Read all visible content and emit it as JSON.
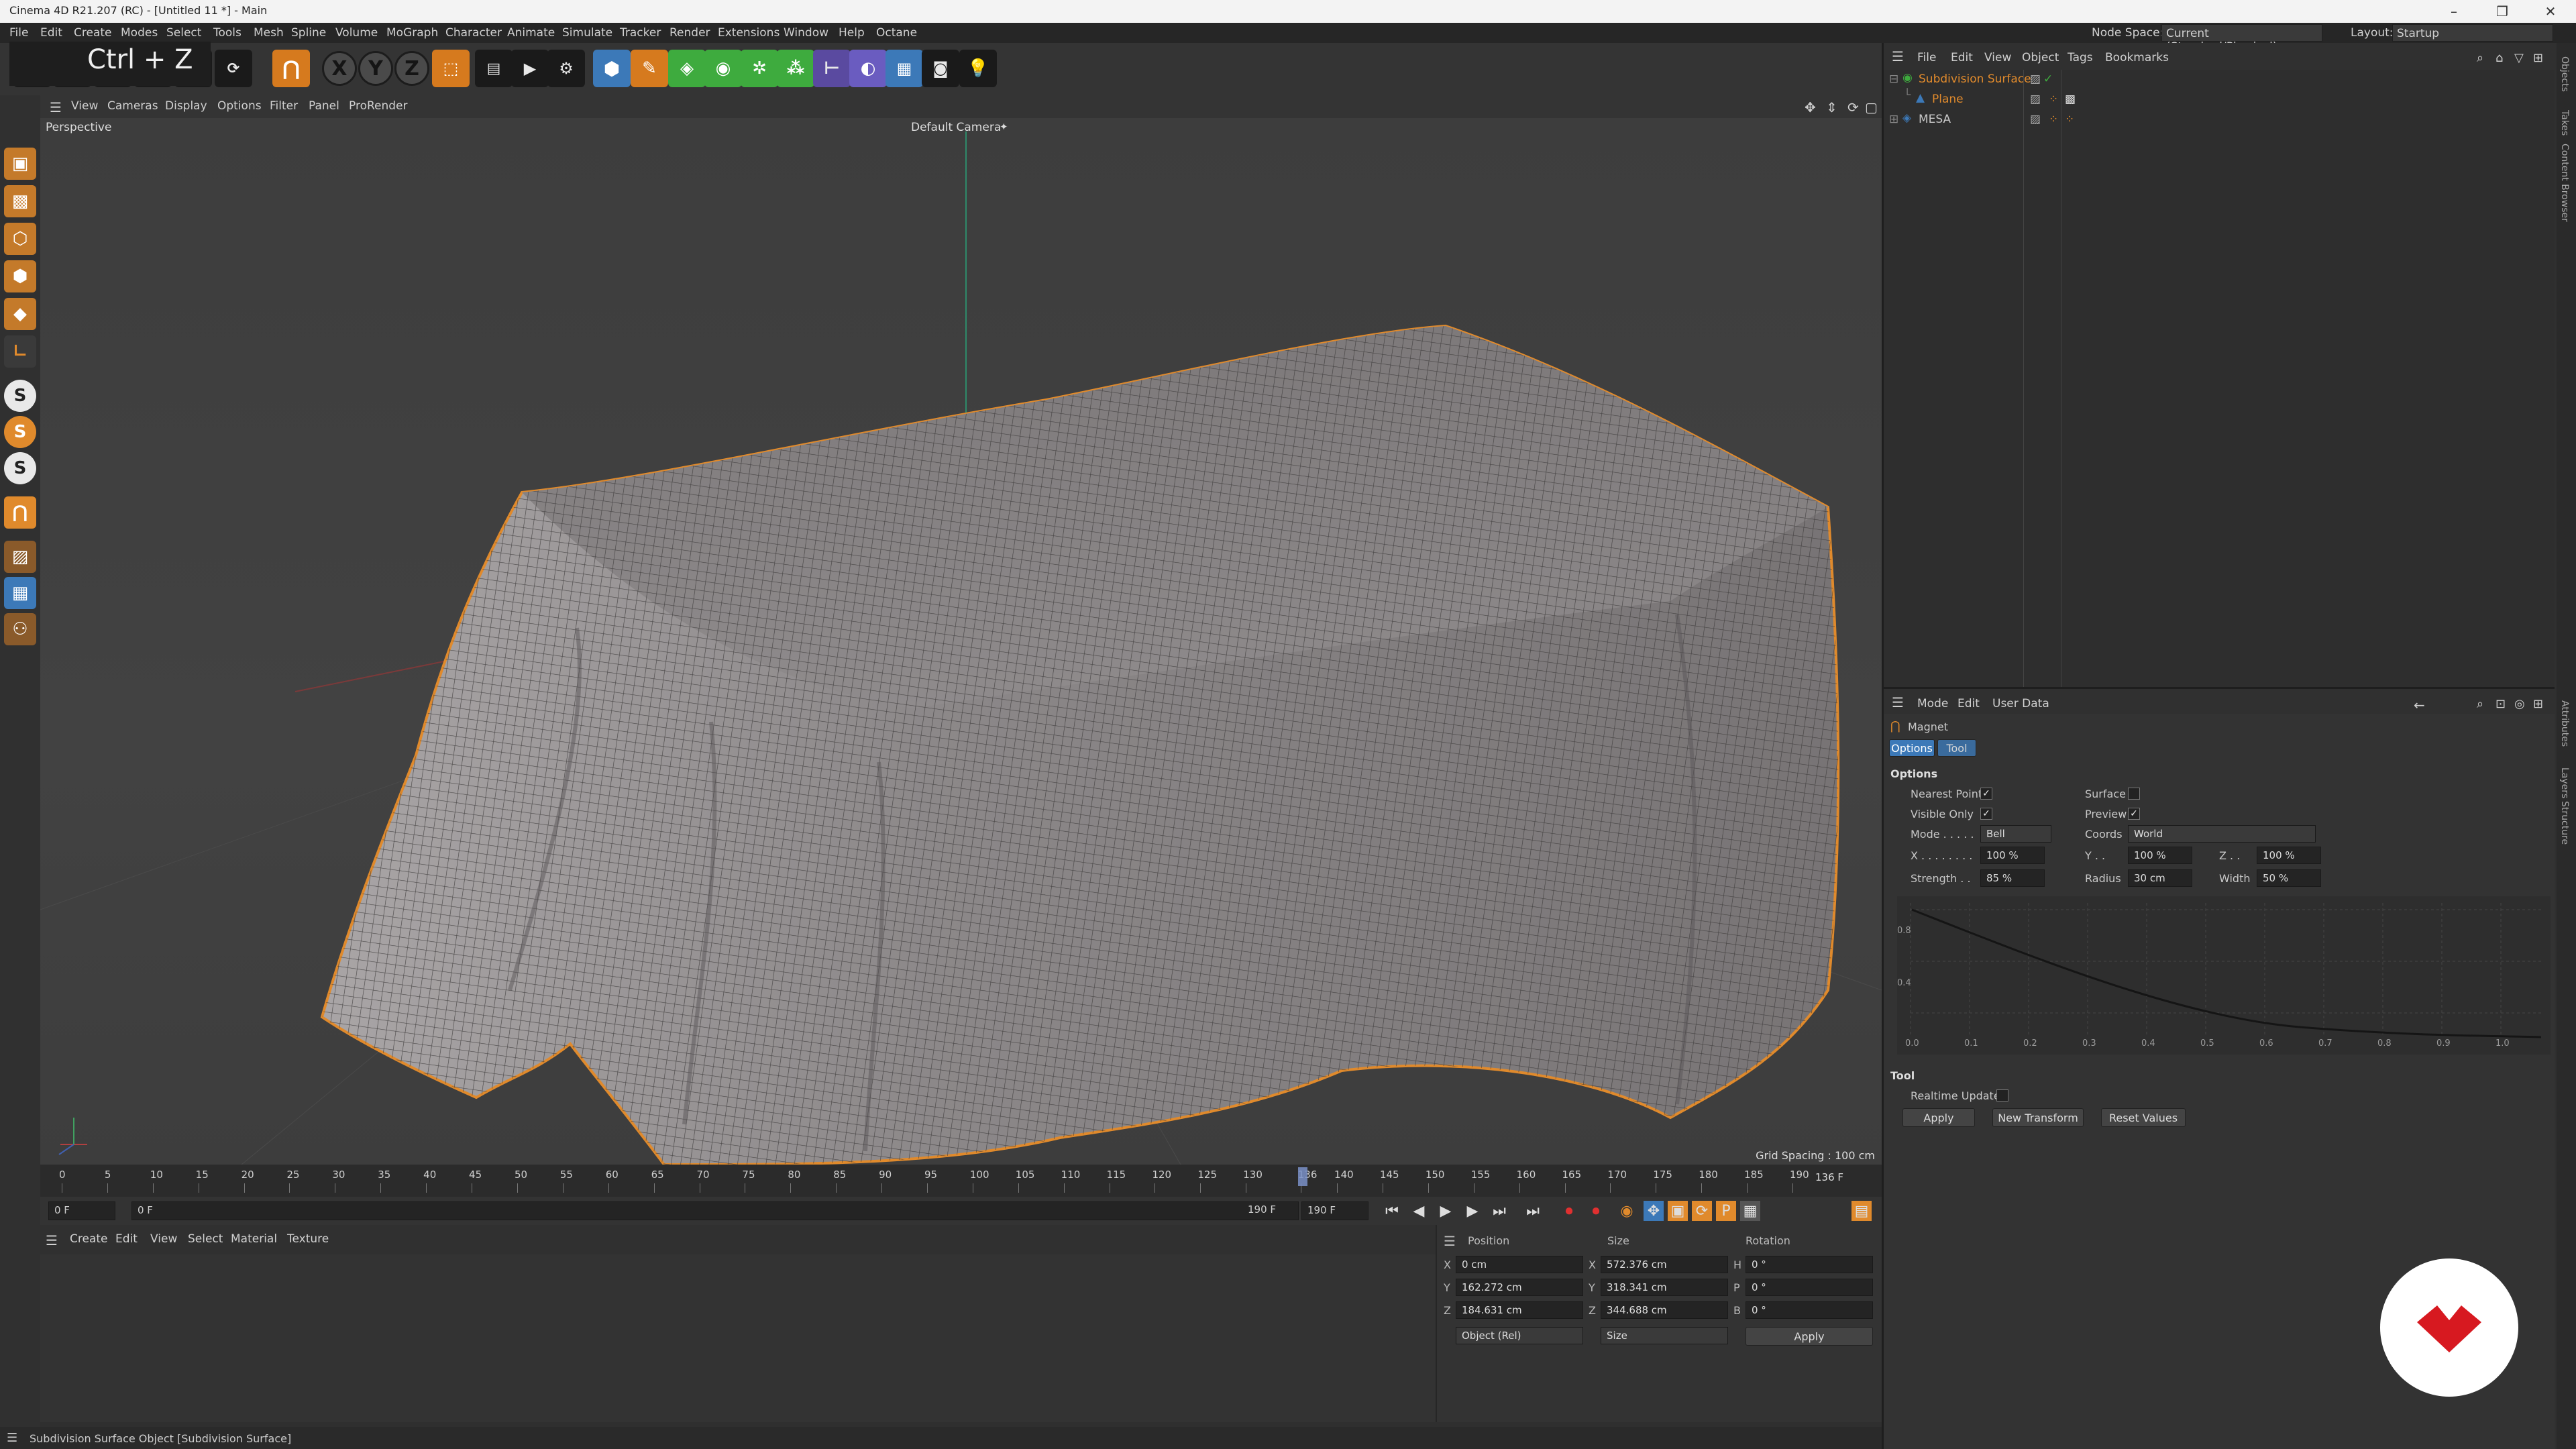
{
  "window": {
    "title": "Cinema 4D R21.207 (RC) - [Untitled 11 *] - Main",
    "controls": [
      "minimize-icon",
      "restore-icon",
      "close-icon"
    ]
  },
  "shortcut_overlay": "Ctrl + Z",
  "menubar": {
    "items": [
      "File",
      "Edit",
      "Create",
      "Modes",
      "Select",
      "Tools",
      "Mesh",
      "Spline",
      "Volume",
      "MoGraph",
      "Character",
      "Animate",
      "Simulate",
      "Tracker",
      "Render",
      "Extensions",
      "Window",
      "Help",
      "Octane"
    ],
    "node_space_label": "Node Space:",
    "node_space_value": "Current (Standard/Physical)",
    "layout_label": "Layout:",
    "layout_value": "Startup"
  },
  "toolbar": {
    "axis_x": "X",
    "axis_y": "Y",
    "axis_z": "Z"
  },
  "viewport": {
    "menu": [
      "View",
      "Cameras",
      "Display",
      "Options",
      "Filter",
      "Panel",
      "ProRender"
    ],
    "name": "Perspective",
    "camera": "Default Camera",
    "grid_spacing": "Grid Spacing : 100 cm"
  },
  "timeline": {
    "ticks": [
      "0",
      "5",
      "10",
      "15",
      "20",
      "25",
      "30",
      "35",
      "40",
      "45",
      "50",
      "55",
      "60",
      "65",
      "70",
      "75",
      "80",
      "85",
      "90",
      "95",
      "100",
      "105",
      "110",
      "115",
      "120",
      "125",
      "130",
      "136",
      "140",
      "145",
      "150",
      "155",
      "160",
      "165",
      "170",
      "175",
      "180",
      "185",
      "190"
    ],
    "current_marker": "136",
    "current_frame_right": "136 F",
    "playhead_fraction": 0.716
  },
  "transport": {
    "start_frame": "0 F",
    "preview_min": "0 F",
    "preview_max": "190 F",
    "end_frame": "190 F"
  },
  "material_manager": {
    "menu": [
      "Create",
      "Edit",
      "View",
      "Select",
      "Material",
      "Texture"
    ]
  },
  "coordinates": {
    "headers": {
      "position": "Position",
      "size": "Size",
      "rotation": "Rotation"
    },
    "rows": [
      {
        "axis": "X",
        "position": "0 cm",
        "size_axis": "X",
        "size": "572.376 cm",
        "rot_axis": "H",
        "rotation": "0 °"
      },
      {
        "axis": "Y",
        "position": "162.272 cm",
        "size_axis": "Y",
        "size": "318.341 cm",
        "rot_axis": "P",
        "rotation": "0 °"
      },
      {
        "axis": "Z",
        "position": "184.631 cm",
        "size_axis": "Z",
        "size": "344.688 cm",
        "rot_axis": "B",
        "rotation": "0 °"
      }
    ],
    "mode": "Object (Rel)",
    "size_mode": "Size",
    "apply": "Apply"
  },
  "status": "Subdivision Surface Object [Subdivision Surface]",
  "object_manager": {
    "menu": [
      "File",
      "Edit",
      "View",
      "Object",
      "Tags",
      "Bookmarks"
    ],
    "objects": [
      {
        "name": "Subdivision Surface",
        "color": "#e08a2c"
      },
      {
        "name": "Plane",
        "color": "#e08a2c"
      },
      {
        "name": "MESA",
        "color": "#c8c8c8"
      }
    ]
  },
  "attributes": {
    "menu": [
      "Mode",
      "Edit",
      "User Data"
    ],
    "tool_name": "Magnet",
    "tabs": [
      "Options",
      "Tool"
    ],
    "section_options": "Options",
    "nearest_point_label": "Nearest Point",
    "nearest_point_checked": true,
    "surface_label": "Surface",
    "surface_checked": false,
    "visible_only_label": "Visible Only",
    "visible_only_checked": true,
    "preview_label": "Preview",
    "preview_checked": true,
    "mode_label": "Mode . . . . .",
    "mode_value": "Bell",
    "coords_label": "Coords",
    "coords_value": "World",
    "x_label": "X . . . . . . . .",
    "x_value": "100 %",
    "y_label": "Y . .",
    "y_value": "100 %",
    "z_label": "Z . .",
    "z_value": "100 %",
    "strength_label": "Strength . .",
    "strength_value": "85 %",
    "radius_label": "Radius",
    "radius_value": "30 cm",
    "width_label": "Width",
    "width_value": "50 %",
    "graph_y_labels": [
      "0.8",
      "0.4"
    ],
    "graph_x_labels": [
      "0.0",
      "0.1",
      "0.2",
      "0.3",
      "0.4",
      "0.5",
      "0.6",
      "0.7",
      "0.8",
      "0.9",
      "1.0"
    ],
    "section_tool": "Tool",
    "realtime_label": "Realtime Update",
    "realtime_checked": false,
    "apply": "Apply",
    "new_transform": "New Transform",
    "reset_values": "Reset Values"
  },
  "side_tabs": [
    "Objects",
    "Takes",
    "Content Browser",
    "Attributes",
    "Layers",
    "Structure"
  ],
  "colors": {
    "accent_blue": "#3c79b8",
    "selection_orange": "#e08a2c",
    "logo_red": "#d71920"
  }
}
